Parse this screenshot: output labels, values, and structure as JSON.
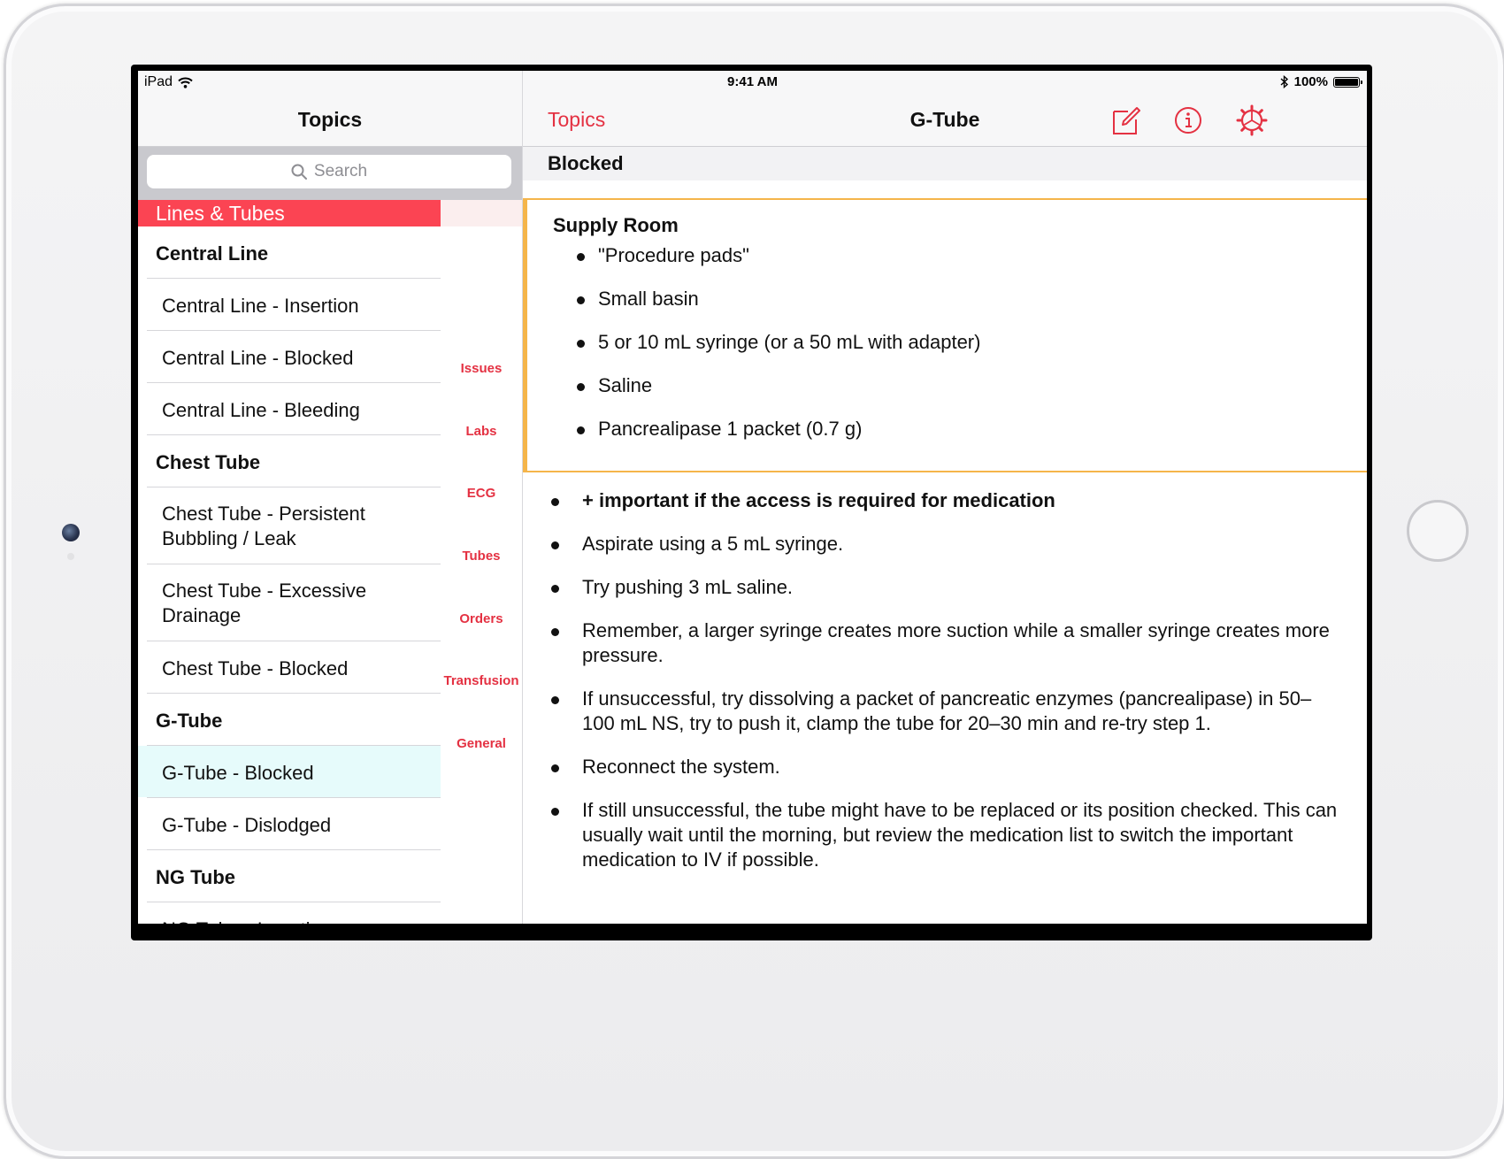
{
  "status_bar": {
    "device": "iPad",
    "time": "9:41 AM",
    "battery": "100%",
    "battery_level": 1.0
  },
  "master": {
    "title": "Topics",
    "search_placeholder": "Search",
    "section_header": "Lines & Tubes",
    "rows": [
      {
        "label": "Central Line",
        "kind": "group"
      },
      {
        "label": "Central Line - Insertion",
        "kind": "item"
      },
      {
        "label": "Central Line - Blocked",
        "kind": "item"
      },
      {
        "label": "Central Line - Bleeding",
        "kind": "item"
      },
      {
        "label": "Chest Tube",
        "kind": "group"
      },
      {
        "label": "Chest Tube - Persistent Bubbling / Leak",
        "kind": "item"
      },
      {
        "label": "Chest Tube - Excessive Drainage",
        "kind": "item"
      },
      {
        "label": "Chest Tube - Blocked",
        "kind": "item"
      },
      {
        "label": "G-Tube",
        "kind": "group"
      },
      {
        "label": "G-Tube - Blocked",
        "kind": "item",
        "selected": true
      },
      {
        "label": "G-Tube - Dislodged",
        "kind": "item"
      },
      {
        "label": "NG Tube",
        "kind": "group"
      },
      {
        "label": "NG Tube - Insertion",
        "kind": "item"
      }
    ],
    "index": [
      "Issues",
      "Labs",
      "ECG",
      "Tubes",
      "Orders",
      "Transfusion",
      "General"
    ]
  },
  "detail": {
    "back_label": "Topics",
    "title": "G-Tube",
    "icons": [
      "compose-icon",
      "info-icon",
      "settings-gear-icon"
    ],
    "section_title": "Blocked",
    "supply": {
      "title": "Supply Room",
      "items": [
        "\"Procedure pads\"",
        "Small basin",
        "5 or 10 mL syringe (or a 50 mL with adapter)",
        "Saline",
        "Pancrealipase 1 packet (0.7 g)"
      ]
    },
    "steps": [
      {
        "text": "+ important if the access is required for medication",
        "bold": true
      },
      {
        "text": "Aspirate using a 5 mL syringe."
      },
      {
        "text": "Try pushing 3 mL saline."
      },
      {
        "text": "Remember, a larger syringe creates more suction while a smaller syringe creates more pressure."
      },
      {
        "text": "If unsuccessful, try dissolving a packet of pancreatic enzymes (pancrealipase) in 50–100 mL NS, try to push it, clamp the tube for 20–30 min and re-try step 1."
      },
      {
        "text": "Reconnect the system."
      },
      {
        "text": "If still unsuccessful, the tube might have to be replaced or its position checked. This can usually wait until the morning, but review the medication list to switch the important medication to IV if possible."
      }
    ]
  },
  "colors": {
    "accent": "#e43142",
    "section_header": "#fb4453",
    "highlight_border": "#f5b54a",
    "selected_row": "#e6fbfb"
  }
}
